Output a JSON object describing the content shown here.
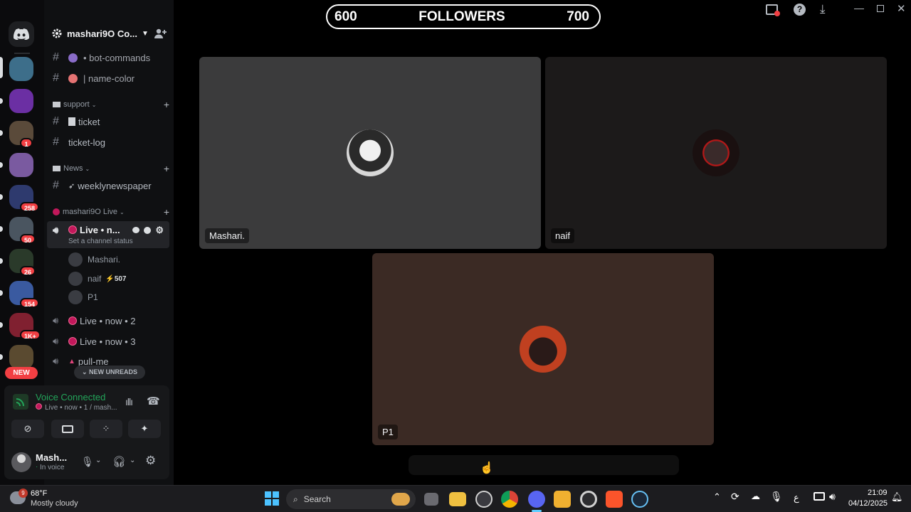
{
  "window": {
    "banner_left": "600",
    "banner_title": "FOLLOWERS",
    "banner_right": "700"
  },
  "server": {
    "name": "mashari9O Co..."
  },
  "servers": [
    {
      "name": "server-1",
      "color": "#3d6e8a",
      "badge": ""
    },
    {
      "name": "server-2",
      "color": "#6b2fa3",
      "badge": ""
    },
    {
      "name": "server-3",
      "color": "#5a4a3a",
      "badge": "1"
    },
    {
      "name": "server-4",
      "color": "#7a5aa0",
      "badge": ""
    },
    {
      "name": "server-5",
      "color": "#2e3a6e",
      "badge": "258"
    },
    {
      "name": "server-6",
      "color": "#4a5560",
      "badge": "50"
    },
    {
      "name": "server-7",
      "color": "#2a3a2a",
      "badge": "26"
    },
    {
      "name": "server-8",
      "color": "#3a5aa0",
      "badge": "154"
    },
    {
      "name": "server-9",
      "color": "#802030",
      "badge": "1K+"
    },
    {
      "name": "server-10",
      "color": "#5a4a30",
      "badge": ""
    }
  ],
  "rail_new_label": "NEW",
  "channels": {
    "bot_commands": "• bot-commands",
    "name_color": "| name-color",
    "cat_support": "support",
    "ticket": "ticket",
    "ticket_log": "ticket-log",
    "cat_news": "News",
    "weekly": "weeklynewspaper",
    "cat_live": "mashari9O Live",
    "live_active": "Live • n...",
    "status_hint": "Set a channel status",
    "live2": "Live • now • 2",
    "live3": "Live • now • 3",
    "pull_me": "pull-me"
  },
  "voice_users": [
    {
      "name": "Mashari.",
      "extra": ""
    },
    {
      "name": "naif",
      "extra": "507"
    },
    {
      "name": "P1",
      "extra": ""
    }
  ],
  "new_unreads": "NEW UNREADS",
  "voice_panel": {
    "status": "Voice Connected",
    "sub": "Live • now • 1 / mash..."
  },
  "user_panel": {
    "name": "Mash...",
    "status": "In voice"
  },
  "tiles": [
    {
      "name": "Mashari.",
      "bg": "#3b3b3c"
    },
    {
      "name": "naif",
      "bg": "#1c1a1a"
    },
    {
      "name": "P1",
      "bg": "#3b2a24"
    }
  ],
  "taskbar": {
    "weather_temp": "68°F",
    "weather_desc": "Mostly cloudy",
    "weather_badge": "9",
    "search_placeholder": "Search",
    "time": "21:09",
    "date": "04/12/2025",
    "lang": "ع"
  }
}
